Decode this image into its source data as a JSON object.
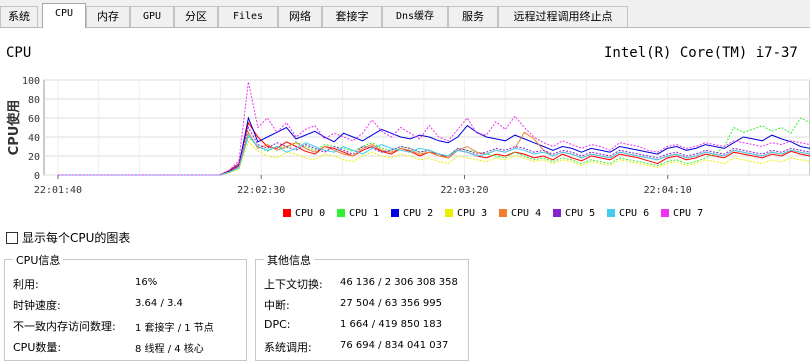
{
  "tabs": [
    {
      "label": "系统",
      "active": false
    },
    {
      "label": "CPU",
      "active": true
    },
    {
      "label": "内存",
      "active": false
    },
    {
      "label": "GPU",
      "active": false
    },
    {
      "label": "分区",
      "active": false
    },
    {
      "label": "Files",
      "active": false
    },
    {
      "label": "网络",
      "active": false
    },
    {
      "label": "套接字",
      "active": false
    },
    {
      "label": "Dns缓存",
      "active": false
    },
    {
      "label": "服务",
      "active": false
    },
    {
      "label": "远程过程调用终止点",
      "active": false
    }
  ],
  "header": {
    "title": "CPU",
    "model": "Intel(R) Core(TM) i7-37"
  },
  "chart_data": {
    "type": "line",
    "ylabel": "CPU使用",
    "ylim": [
      0,
      100
    ],
    "yticks": [
      "100",
      "80",
      "60",
      "40",
      "20",
      "0"
    ],
    "xticks": [
      "22:01:40",
      "22:02:30",
      "22:03:20",
      "22:04:10"
    ],
    "x_start": "22:01:40",
    "x_end": "22:04:45",
    "grid": true,
    "legend_position": "bottom",
    "series": [
      {
        "name": "CPU 0",
        "color": "#ff0000",
        "values": [
          0,
          0,
          0,
          0,
          0,
          0,
          0,
          0,
          0,
          0,
          0,
          0,
          0,
          0,
          0,
          0,
          0,
          0,
          5,
          12,
          55,
          40,
          30,
          28,
          35,
          30,
          25,
          22,
          30,
          28,
          24,
          20,
          26,
          30,
          25,
          22,
          28,
          25,
          20,
          24,
          22,
          18,
          26,
          24,
          20,
          18,
          22,
          20,
          24,
          22,
          18,
          20,
          16,
          22,
          18,
          15,
          20,
          18,
          16,
          22,
          20,
          18,
          15,
          12,
          18,
          20,
          16,
          18,
          22,
          20,
          18,
          24,
          22,
          20,
          18,
          22,
          20,
          25,
          22,
          20
        ]
      },
      {
        "name": "CPU 1",
        "color": "#33ee33",
        "values": [
          0,
          0,
          0,
          0,
          0,
          0,
          0,
          0,
          0,
          0,
          0,
          0,
          0,
          0,
          0,
          0,
          0,
          0,
          3,
          8,
          40,
          30,
          25,
          30,
          28,
          35,
          30,
          26,
          32,
          30,
          28,
          25,
          30,
          34,
          28,
          26,
          30,
          28,
          24,
          26,
          22,
          20,
          28,
          26,
          24,
          22,
          20,
          18,
          24,
          20,
          16,
          18,
          14,
          18,
          16,
          12,
          16,
          14,
          12,
          18,
          16,
          14,
          12,
          10,
          14,
          16,
          12,
          14,
          18,
          22,
          30,
          50,
          45,
          48,
          52,
          46,
          50,
          44,
          60,
          55
        ]
      },
      {
        "name": "CPU 2",
        "color": "#0000dd",
        "values": [
          0,
          0,
          0,
          0,
          0,
          0,
          0,
          0,
          0,
          0,
          0,
          0,
          0,
          0,
          0,
          0,
          0,
          0,
          4,
          10,
          60,
          35,
          40,
          45,
          50,
          38,
          42,
          46,
          40,
          35,
          44,
          40,
          36,
          42,
          48,
          44,
          40,
          38,
          42,
          40,
          36,
          34,
          40,
          52,
          45,
          40,
          38,
          36,
          42,
          38,
          34,
          30,
          26,
          30,
          28,
          24,
          28,
          26,
          24,
          30,
          28,
          26,
          24,
          22,
          28,
          30,
          26,
          28,
          32,
          30,
          28,
          34,
          40,
          38,
          36,
          42,
          38,
          35,
          30,
          28
        ]
      },
      {
        "name": "CPU 3",
        "color": "#eeee00",
        "values": [
          0,
          0,
          0,
          0,
          0,
          0,
          0,
          0,
          0,
          0,
          0,
          0,
          0,
          0,
          0,
          0,
          0,
          0,
          2,
          6,
          35,
          25,
          20,
          18,
          24,
          22,
          18,
          16,
          22,
          20,
          16,
          14,
          20,
          24,
          20,
          18,
          22,
          20,
          16,
          18,
          14,
          12,
          20,
          18,
          16,
          14,
          18,
          16,
          20,
          18,
          14,
          16,
          12,
          16,
          14,
          10,
          14,
          12,
          10,
          16,
          14,
          12,
          10,
          8,
          12,
          14,
          10,
          12,
          16,
          14,
          12,
          18,
          16,
          14,
          12,
          16,
          14,
          18,
          16,
          14
        ]
      },
      {
        "name": "CPU 4",
        "color": "#f08030",
        "values": [
          0,
          0,
          0,
          0,
          0,
          0,
          0,
          0,
          0,
          0,
          0,
          0,
          0,
          0,
          0,
          0,
          0,
          0,
          3,
          9,
          45,
          28,
          32,
          26,
          30,
          34,
          28,
          24,
          30,
          26,
          22,
          20,
          28,
          32,
          26,
          24,
          28,
          26,
          22,
          24,
          20,
          18,
          26,
          30,
          24,
          22,
          26,
          24,
          28,
          45,
          38,
          26,
          20,
          24,
          22,
          18,
          22,
          20,
          18,
          24,
          22,
          20,
          18,
          16,
          20,
          22,
          18,
          20,
          24,
          22,
          20,
          26,
          24,
          22,
          20,
          24,
          22,
          26,
          24,
          22
        ]
      },
      {
        "name": "CPU 5",
        "color": "#8822cc",
        "values": [
          0,
          0,
          0,
          0,
          0,
          0,
          0,
          0,
          0,
          0,
          0,
          0,
          0,
          0,
          0,
          0,
          0,
          0,
          4,
          11,
          50,
          32,
          28,
          34,
          30,
          26,
          32,
          28,
          24,
          30,
          26,
          22,
          30,
          28,
          24,
          26,
          30,
          28,
          24,
          26,
          22,
          20,
          28,
          26,
          22,
          24,
          28,
          26,
          30,
          28,
          24,
          26,
          22,
          26,
          24,
          20,
          24,
          22,
          20,
          26,
          24,
          22,
          20,
          18,
          22,
          24,
          20,
          22,
          26,
          24,
          22,
          28,
          26,
          24,
          22,
          26,
          24,
          28,
          26,
          24
        ]
      },
      {
        "name": "CPU 6",
        "color": "#44ccee",
        "values": [
          0,
          0,
          0,
          0,
          0,
          0,
          0,
          0,
          0,
          0,
          0,
          0,
          0,
          0,
          0,
          0,
          0,
          0,
          3,
          7,
          42,
          30,
          26,
          30,
          24,
          28,
          34,
          30,
          26,
          24,
          30,
          26,
          22,
          28,
          32,
          28,
          26,
          24,
          28,
          26,
          22,
          20,
          26,
          24,
          20,
          22,
          26,
          24,
          28,
          26,
          22,
          24,
          20,
          24,
          22,
          18,
          22,
          20,
          18,
          24,
          22,
          20,
          18,
          16,
          20,
          22,
          18,
          20,
          24,
          22,
          20,
          26,
          24,
          22,
          20,
          24,
          22,
          26,
          24,
          22
        ]
      },
      {
        "name": "CPU 7",
        "color": "#ee33ee",
        "values": [
          0,
          0,
          0,
          0,
          0,
          0,
          0,
          0,
          0,
          0,
          0,
          0,
          0,
          0,
          0,
          0,
          0,
          0,
          5,
          15,
          98,
          50,
          60,
          45,
          55,
          40,
          48,
          52,
          38,
          44,
          40,
          36,
          44,
          58,
          46,
          40,
          50,
          44,
          38,
          52,
          40,
          36,
          48,
          60,
          44,
          42,
          56,
          48,
          62,
          50,
          40,
          34,
          30,
          36,
          32,
          28,
          32,
          30,
          26,
          34,
          32,
          30,
          26,
          24,
          30,
          32,
          28,
          30,
          34,
          32,
          30,
          36,
          34,
          32,
          30,
          34,
          32,
          36,
          34,
          32
        ]
      }
    ]
  },
  "show_each_cpu": {
    "label": "显示每个CPU的图表",
    "checked": false
  },
  "cpu_info": {
    "title": "CPU信息",
    "rows": [
      {
        "label": "利用:",
        "value": "16%"
      },
      {
        "label": "时钟速度:",
        "value": "3.64 / 3.4"
      },
      {
        "label": "不一致内存访问数理:",
        "value": "1 套接字 / 1 节点"
      },
      {
        "label": "CPU数量:",
        "value": "8 线程 / 4 核心"
      }
    ]
  },
  "other_info": {
    "title": "其他信息",
    "rows": [
      {
        "label": "上下文切换:",
        "value": "46 136 / 2 306 308 358"
      },
      {
        "label": "中断:",
        "value": "27 504 / 63 356 995"
      },
      {
        "label": "DPC:",
        "value": "1 664 / 419 850 183"
      },
      {
        "label": "系统调用:",
        "value": "76 694 / 834 041 037"
      }
    ]
  }
}
